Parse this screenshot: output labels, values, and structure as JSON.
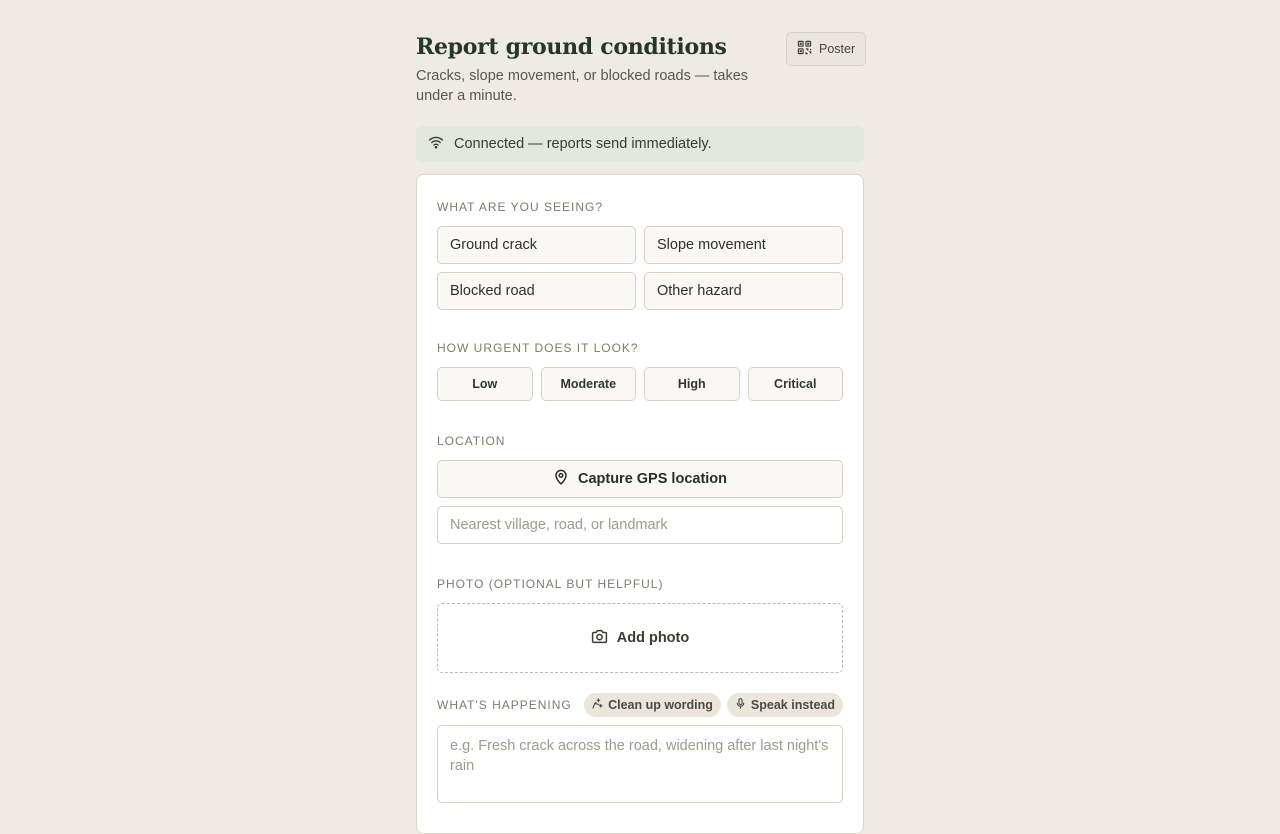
{
  "header": {
    "title": "Report ground conditions",
    "subtitle": "Cracks, slope movement, or blocked roads — takes under a minute.",
    "poster_label": "Poster"
  },
  "status": {
    "text": "Connected — reports send immediately."
  },
  "hazard": {
    "label": "What are you seeing?",
    "options": [
      "Ground crack",
      "Slope movement",
      "Blocked road",
      "Other hazard"
    ]
  },
  "urgency": {
    "label": "How urgent does it look?",
    "options": [
      "Low",
      "Moderate",
      "High",
      "Critical"
    ]
  },
  "location": {
    "label": "Location",
    "gps_label": "Capture GPS location",
    "placeholder": "Nearest village, road, or landmark"
  },
  "photo": {
    "label": "Photo (optional but helpful)",
    "add_label": "Add photo"
  },
  "happening": {
    "label": "What's happening",
    "cleanup_label": "Clean up wording",
    "speak_label": "Speak instead",
    "placeholder": "e.g. Fresh crack across the road, widening after last night's rain"
  },
  "icons": {
    "poster": "qr-code-icon",
    "status": "wifi-icon",
    "gps": "map-pin-icon",
    "photo": "camera-icon",
    "cleanup": "sparkle-icon",
    "speak": "microphone-icon"
  }
}
